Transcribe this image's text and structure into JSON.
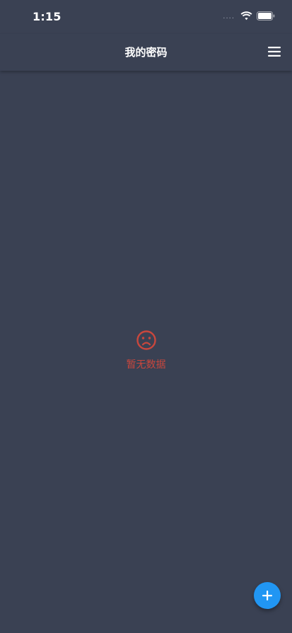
{
  "status_bar": {
    "time": "1:15",
    "signal": "....",
    "icons": [
      "wifi-icon",
      "battery-icon"
    ]
  },
  "app_bar": {
    "title": "我的密码",
    "menu_icon": "hamburger-menu-icon"
  },
  "empty_state": {
    "icon": "sad-face-icon",
    "text": "暂无数据",
    "color": "#c9473d"
  },
  "fab": {
    "icon": "plus-icon",
    "color": "#2196f3"
  },
  "theme": {
    "background": "#3a4153"
  }
}
